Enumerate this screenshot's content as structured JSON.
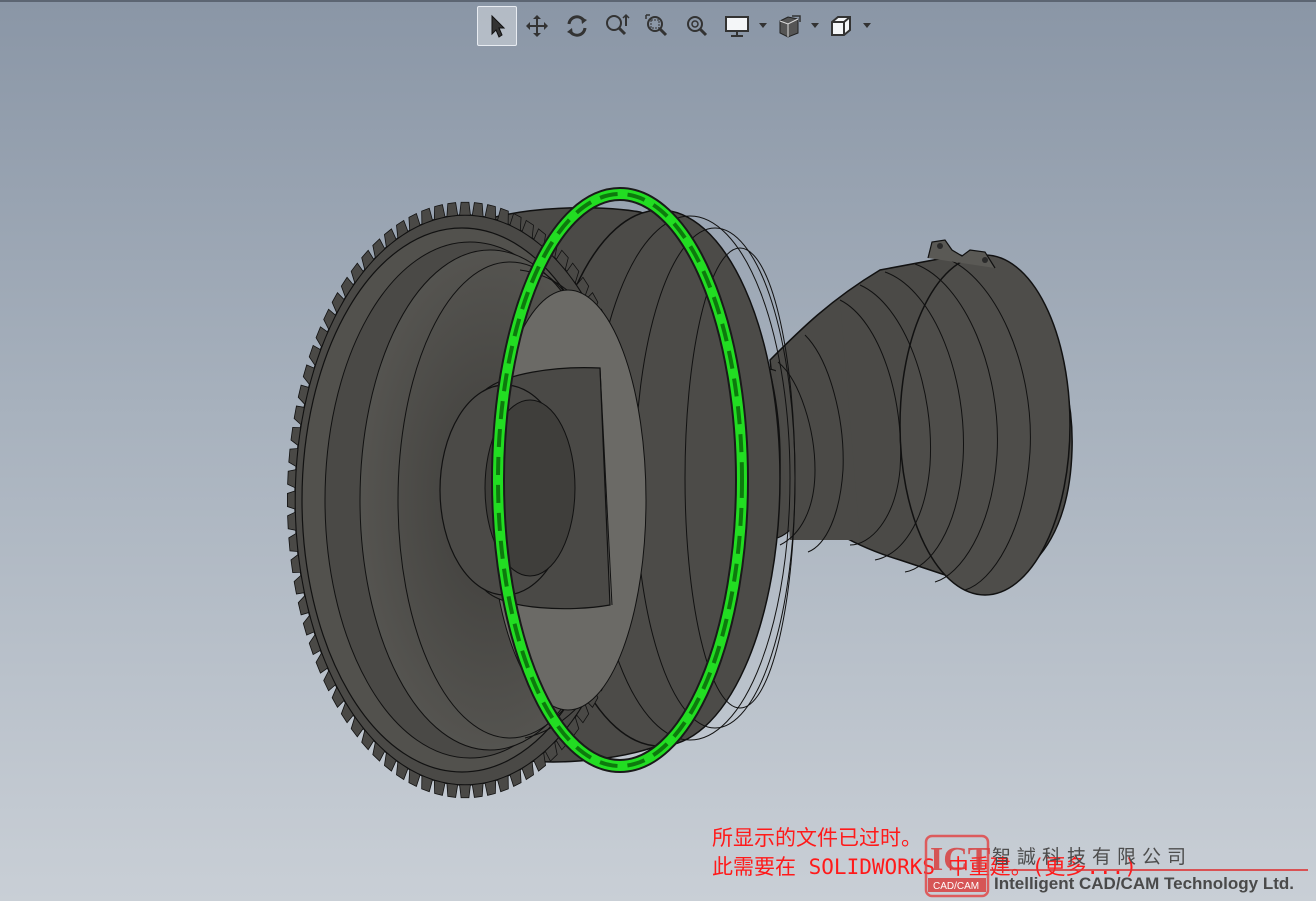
{
  "toolbar": {
    "items": [
      {
        "icon": "select-arrow-icon",
        "tooltip": ""
      },
      {
        "icon": "pan-icon",
        "tooltip": ""
      },
      {
        "icon": "rotate-icon",
        "tooltip": ""
      },
      {
        "icon": "zoom-to-fit-icon",
        "tooltip": ""
      },
      {
        "icon": "zoom-to-area-icon",
        "tooltip": ""
      },
      {
        "icon": "zoom-in-out-icon",
        "tooltip": ""
      },
      {
        "icon": "display-style-icon",
        "tooltip": ""
      },
      {
        "icon": "hide-show-items-icon",
        "tooltip": ""
      },
      {
        "icon": "view-orientation-icon",
        "tooltip": ""
      }
    ],
    "active_index": 0
  },
  "model": {
    "body_color": "#4b4a47",
    "edge_color": "#111111",
    "selected_part_color": "#22dd22"
  },
  "message": {
    "line1": "所显示的文件已过时。",
    "line2": "此需要在 SOLIDWORKS 中重建。(更多...)",
    "color": "#ff1a1a"
  },
  "watermark": {
    "logo_text": "ICT",
    "logo_sub": "CAD/CAM",
    "company_cn": "智誠科技有限公司",
    "company_en": "Intelligent CAD/CAM Technology Ltd."
  }
}
